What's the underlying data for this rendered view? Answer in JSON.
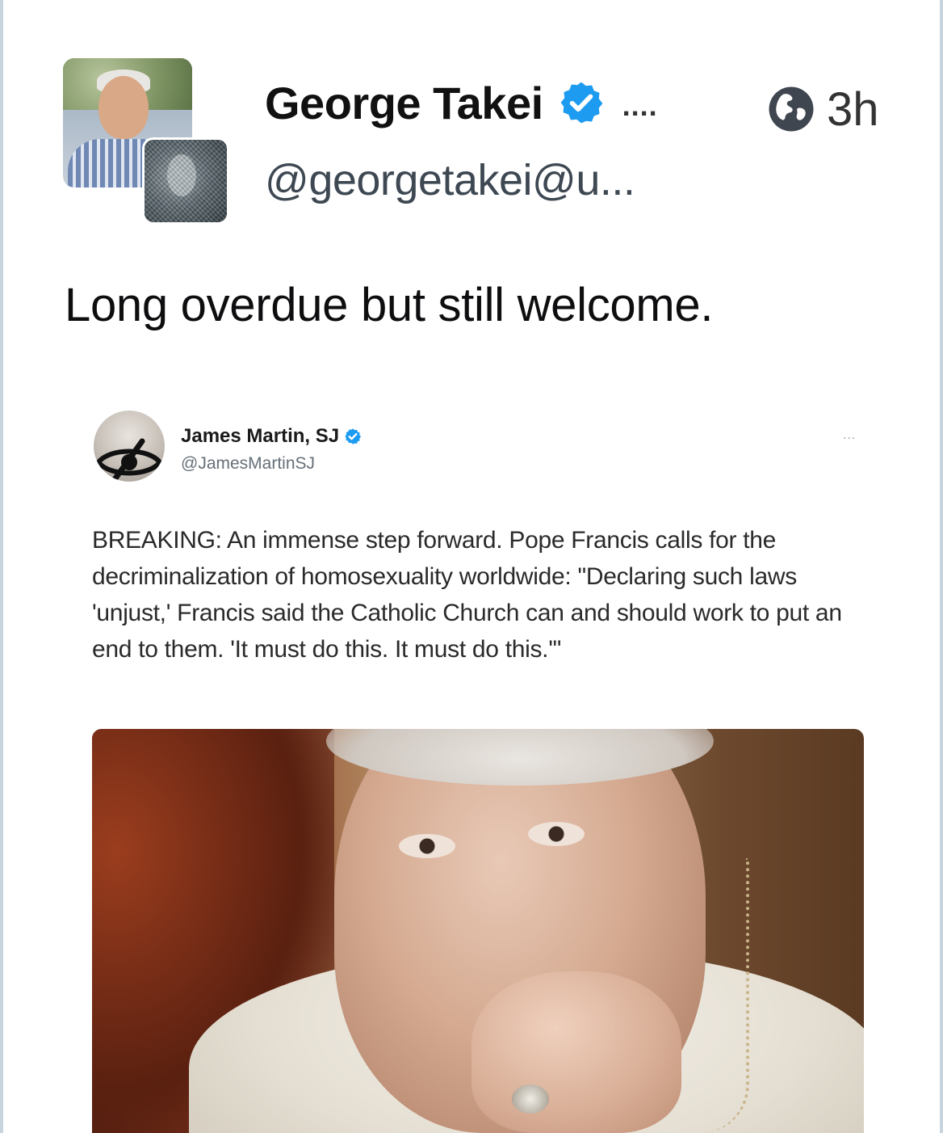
{
  "post": {
    "author": {
      "display_name": "George Takei",
      "handle": "@georgetakei@u...",
      "verified": true
    },
    "more_label": "....",
    "visibility_icon": "globe-icon",
    "timestamp": "3h",
    "text": "Long overdue but still welcome."
  },
  "embedded_tweet": {
    "author": {
      "display_name": "James Martin, SJ",
      "handle": "@JamesMartinSJ",
      "verified": true
    },
    "more_label": "...",
    "text": "BREAKING: An immense step forward. Pope Francis calls for the decriminalization of homosexuality worldwide: \"Declaring such laws 'unjust,' Francis said the Catholic Church can and should work to put an end to them. 'It must do this. It must do this.'\""
  },
  "colors": {
    "verified_blue": "#1d9bf0",
    "frame_border": "#c9d3dc",
    "handle_gray": "#3e4852"
  }
}
